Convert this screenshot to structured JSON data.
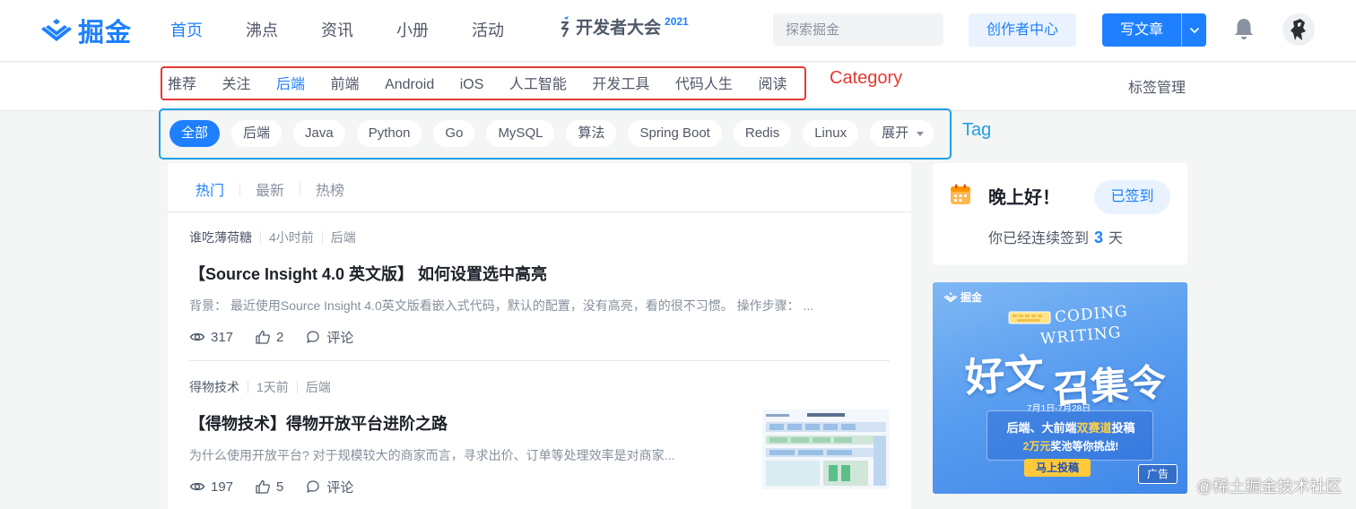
{
  "header": {
    "logo_text": "掘金",
    "nav": [
      "首页",
      "沸点",
      "资讯",
      "小册",
      "活动"
    ],
    "conference": {
      "text": "开发者大会",
      "year": "2021"
    },
    "search_placeholder": "探索掘金",
    "creator_label": "创作者中心",
    "write_label": "写文章"
  },
  "categories": {
    "items": [
      "推荐",
      "关注",
      "后端",
      "前端",
      "Android",
      "iOS",
      "人工智能",
      "开发工具",
      "代码人生",
      "阅读"
    ],
    "active": "后端",
    "annotation": "Category",
    "manage_label": "标签管理"
  },
  "tags": {
    "items": [
      "全部",
      "后端",
      "Java",
      "Python",
      "Go",
      "MySQL",
      "算法",
      "Spring Boot",
      "Redis",
      "Linux"
    ],
    "expand_label": "展开",
    "annotation": "Tag"
  },
  "feed": {
    "tabs": [
      "热门",
      "最新",
      "热榜"
    ],
    "articles": [
      {
        "author": "谁吃薄荷糖",
        "time": "4小时前",
        "tag": "后端",
        "title": "【Source Insight 4.0 英文版】 如何设置选中高亮",
        "abstract": "背景： 最近使用Source Insight 4.0英文版看嵌入式代码，默认的配置，没有高亮，看的很不习惯。 操作步骤： ...",
        "views": "317",
        "likes": "2",
        "comment_label": "评论"
      },
      {
        "author": "得物技术",
        "time": "1天前",
        "tag": "后端",
        "title": "【得物技术】得物开放平台进阶之路",
        "abstract": "为什么使用开放平台? 对于规模较大的商家而言，寻求出价、订单等处理效率是对商家...",
        "views": "197",
        "likes": "5",
        "comment_label": "评论"
      }
    ]
  },
  "signin": {
    "greeting": "晚上好！",
    "button_label": "已签到",
    "streak_prefix": "你已经连续签到",
    "streak_days": "3",
    "streak_suffix": "天"
  },
  "ad": {
    "logo_text": "掘金",
    "english_line1": "CODING",
    "english_line2": "WRITING",
    "title_a": "好文",
    "title_b": "召集令",
    "date": "7月1日-7月28日",
    "line1_a": "后端、大前端",
    "line1_hl": "双赛道",
    "line1_b": "投稿",
    "line2_hl": "2万元",
    "line2_b": "奖池等你挑战!",
    "cta": "马上投稿",
    "badge": "广告"
  },
  "watermark": "@稀土掘金技术社区",
  "colors": {
    "brand": "#1e80ff",
    "category_annotation": "#e53935",
    "tag_annotation": "#1fa0e2"
  }
}
